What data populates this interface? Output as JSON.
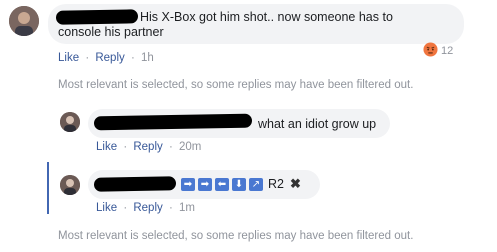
{
  "comment1": {
    "text_line1": "His X-Box got him shot.. now someone has to",
    "text_line2": "console his partner",
    "like": "Like",
    "reply": "Reply",
    "time": "1h",
    "reaction_count": "12"
  },
  "filter_notice_1": "Most relevant is selected, so some replies may have been filtered out.",
  "reply1": {
    "text": "what an idiot grow up",
    "like": "Like",
    "reply": "Reply",
    "time": "20m"
  },
  "reply2": {
    "arrows": [
      "➡",
      "➡",
      "⬅",
      "⬇",
      "↗"
    ],
    "suffix": "R2",
    "close_glyph": "✖",
    "like": "Like",
    "reply": "Reply",
    "time": "1m"
  },
  "filter_notice_2": "Most relevant is selected, so some replies may have been filtered out.",
  "separator": "·",
  "colors": {
    "link": "#385898",
    "muted": "#90949c",
    "bubble": "#f2f3f5",
    "thread_line": "#4267b2",
    "angry_reaction": "#f0753f"
  }
}
